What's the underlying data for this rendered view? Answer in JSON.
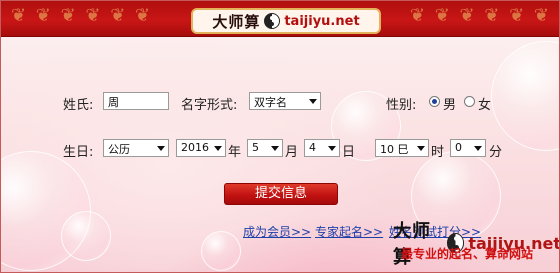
{
  "header": {
    "logo_cn": "大师算",
    "logo_en": "taijiyu.net",
    "ornament": "❦ ❦ ❦ ❦ ❦ ❦"
  },
  "form": {
    "surname_label": "姓氏:",
    "surname_value": "周",
    "name_type_label": "名字形式:",
    "name_type_value": "双字名",
    "gender_label": "性别:",
    "gender_male": "男",
    "gender_female": "女",
    "gender_selected": "男",
    "birth_label": "生日:",
    "calendar_value": "公历",
    "year_value": "2016",
    "year_unit": "年",
    "month_value": "5",
    "month_unit": "月",
    "day_value": "4",
    "day_unit": "日",
    "hour_value": "10 巳",
    "hour_unit": "时",
    "minute_value": "0",
    "minute_unit": "分",
    "submit_label": "提交信息"
  },
  "links": {
    "member": "成为会员>>",
    "expert": "专家起名>>",
    "more": "姓名测试打分>>"
  },
  "brand": {
    "logo_cn": "大师算",
    "logo_en": "taijiyu.net",
    "slogan": "最专业的起名、算命网站"
  },
  "colors": {
    "header_red": "#c01414",
    "link_blue": "#1e3fa8",
    "slogan_red": "#d01010"
  }
}
